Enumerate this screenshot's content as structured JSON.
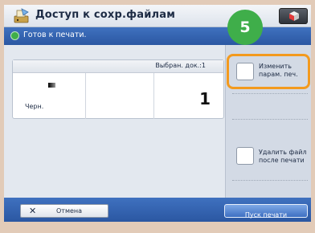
{
  "header": {
    "title": "Доступ  к  сохр.файлам",
    "step_badge": "5",
    "icons": {
      "app": "printer-folder-icon",
      "menu": "menu-cube-icon"
    }
  },
  "status": {
    "text": "Готов к печати.",
    "icon": "ready-status-icon"
  },
  "document": {
    "selected_count": "Выбран. док.:1",
    "color_mode_label": "Черн.",
    "copies": "1",
    "icons": {
      "color_mode": "black-white-gradient-icon"
    }
  },
  "side": {
    "change_print_settings": "Изменить\nпарам. печ.",
    "delete_after_print": "Удалить файл\nпосле печати"
  },
  "footer": {
    "cancel_label": "Отмена",
    "start_print_label": "Пуск печати"
  },
  "colors": {
    "status_bar": "#2b57a2",
    "step_badge": "#3fae4a",
    "highlight": "#f39a1e"
  }
}
